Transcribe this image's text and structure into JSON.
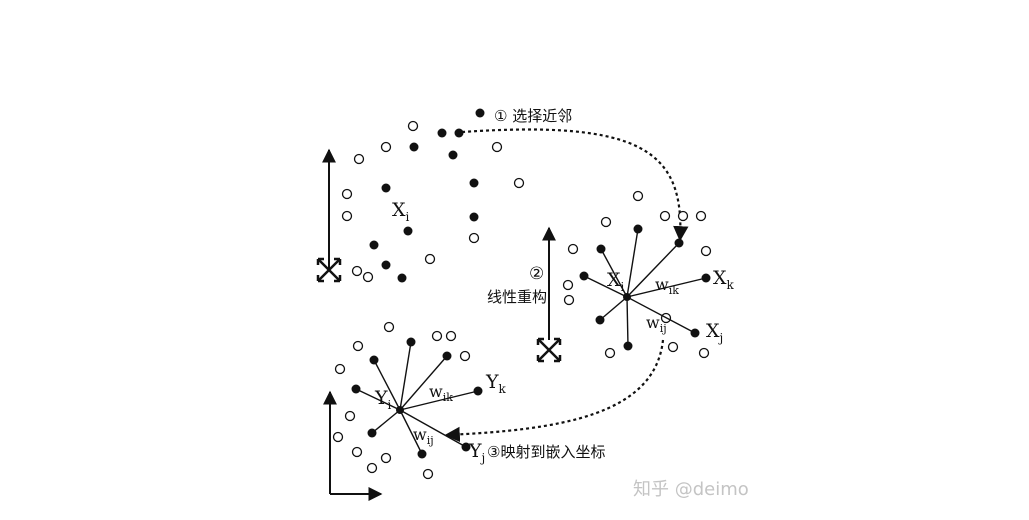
{
  "steps": {
    "step1": "① 选择近邻",
    "step2_num": "②",
    "step2_text": "线性重构",
    "step3": "③映射到嵌入坐标"
  },
  "high_dim": {
    "label_xi": "X",
    "label_xi_sub": "i"
  },
  "reconstruction": {
    "label_xi": "X",
    "label_xi_sub": "i",
    "label_xk": "X",
    "label_xk_sub": "k",
    "label_xj": "X",
    "label_xj_sub": "j",
    "label_wik": "w",
    "label_wik_sub": "ik",
    "label_wij": "w",
    "label_wij_sub": "ij"
  },
  "embedding": {
    "label_yi": "Y",
    "label_yi_sub": "i",
    "label_yk": "Y",
    "label_yk_sub": "k",
    "label_yj": "Y",
    "label_yj_sub": "j",
    "label_wik": "w",
    "label_wik_sub": "ik",
    "label_wij": "w",
    "label_wij_sub": "ij"
  },
  "watermark": "知乎 @deimo"
}
